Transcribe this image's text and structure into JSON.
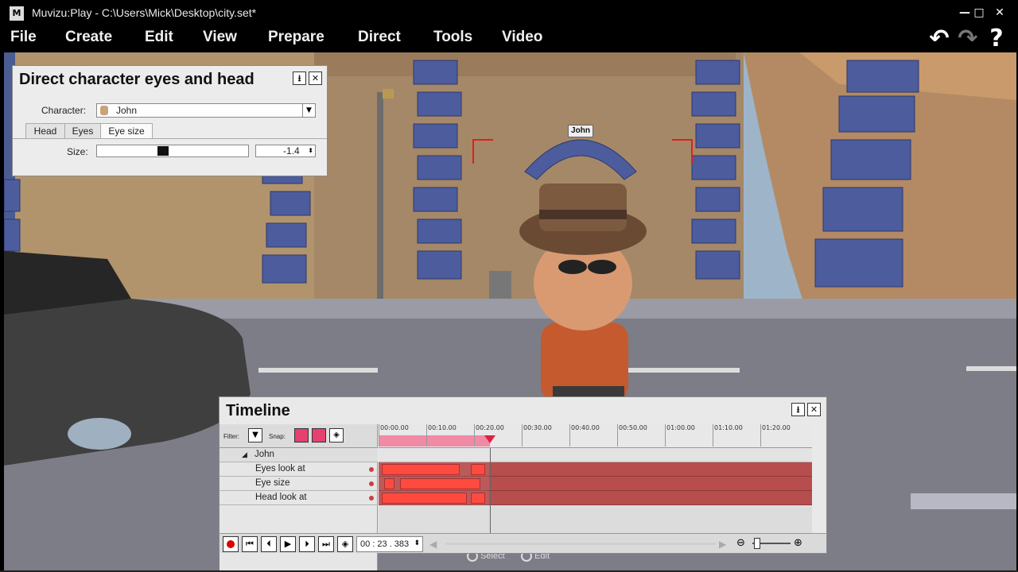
{
  "window": {
    "logo": "M",
    "title": "Muvizu:Play - C:\\Users\\Mick\\Desktop\\city.set*",
    "minimize": "—",
    "maximize": "□",
    "close": "✕"
  },
  "menu": {
    "items": [
      "File",
      "Create",
      "Edit",
      "View",
      "Prepare",
      "Direct",
      "Tools",
      "Video"
    ],
    "undo": "↶",
    "redo": "↷",
    "help": "?"
  },
  "scene": {
    "character_label": "John",
    "overlay_select": "Select",
    "overlay_edit": "Edit"
  },
  "direct_panel": {
    "title": "Direct character eyes and head",
    "pin": "⭳",
    "close": "✕",
    "character_label": "Character:",
    "character_value": "John",
    "tabs": [
      "Head",
      "Eyes",
      "Eye size"
    ],
    "active_tab": "Eye size",
    "size_label": "Size:",
    "size_value": "-1.4",
    "slider_fraction": 0.43
  },
  "timeline": {
    "title": "Timeline",
    "pin": "⭳",
    "close": "✕",
    "filter_label": "Filter:",
    "snap_label": "Snap:",
    "ticks": [
      "00:00.00",
      "00:10.00",
      "00:20.00",
      "00:30.00",
      "00:40.00",
      "00:50.00",
      "01:00.00",
      "01:10.00",
      "01:20.00"
    ],
    "group": "John",
    "tracks": [
      {
        "name": "Eyes look at"
      },
      {
        "name": "Eye size"
      },
      {
        "name": "Head look at"
      }
    ],
    "time_value": "00 : 23 . 383",
    "playhead_seconds": 23.383
  },
  "colors": {
    "accent": "#ff3b30",
    "track": "#b74d4d",
    "range": "#f08aa5"
  }
}
